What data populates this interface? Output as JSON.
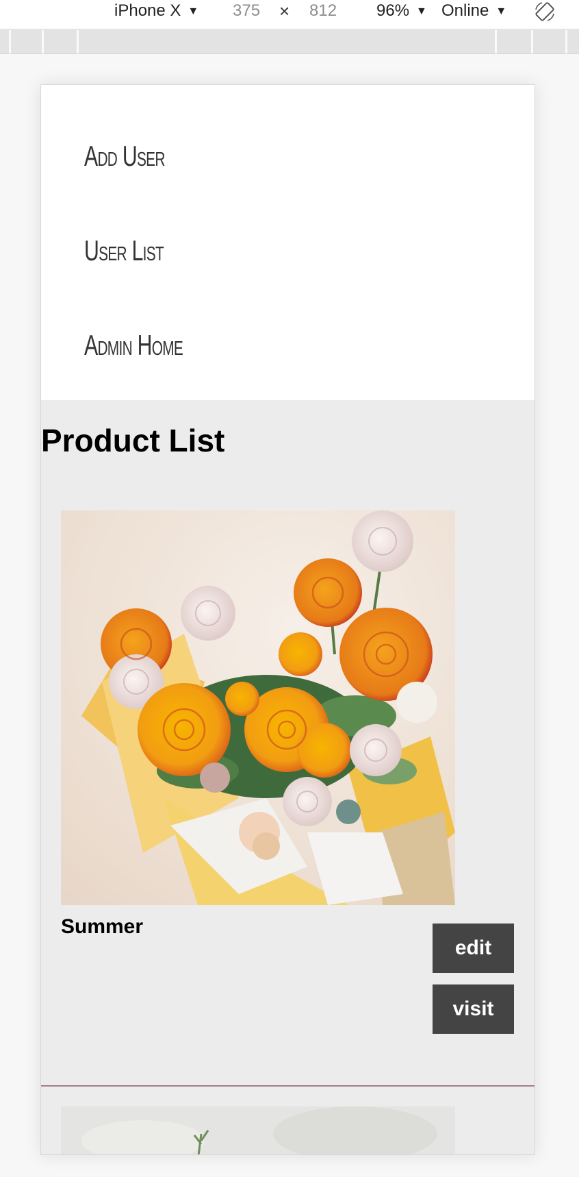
{
  "devtools": {
    "device": "iPhone X",
    "width": "375",
    "times": "×",
    "height": "812",
    "zoom": "96%",
    "throttle": "Online",
    "caret": "▼",
    "icons": {
      "rotate": "rotate-device-icon",
      "dropdown": "triangle-down-icon"
    }
  },
  "nav": {
    "items": [
      {
        "label": "Add User"
      },
      {
        "label": "User List"
      },
      {
        "label": "Admin Home"
      }
    ]
  },
  "main": {
    "title": "Product List",
    "products": [
      {
        "name": "Summer",
        "edit_label": "edit",
        "visit_label": "visit"
      }
    ]
  },
  "colors": {
    "button_bg": "#444444",
    "divider": "#a87c90",
    "page_bg": "#ececec"
  }
}
